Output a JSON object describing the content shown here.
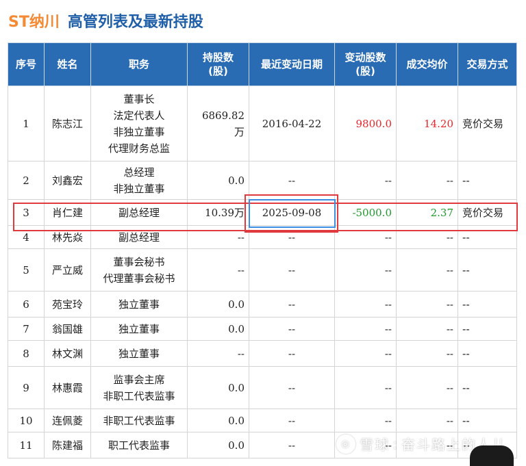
{
  "header": {
    "stock": "ST纳川",
    "title": "高管列表及最新持股"
  },
  "table": {
    "columns": [
      "序号",
      "姓名",
      "职务",
      "持股数\n(股)",
      "最近变动日期",
      "变动股数\n(股)",
      "成交均价",
      "交易方式"
    ],
    "rows": [
      {
        "no": "1",
        "name": "陈志江",
        "position": "董事长\n法定代表人\n非独立董事\n代理财务总监",
        "holding": "6869.82万",
        "date": "2016-04-22",
        "qty": "9800.0",
        "price": "14.20",
        "way": "竞价交易"
      },
      {
        "no": "2",
        "name": "刘鑫宏",
        "position": "总经理\n非独立董事",
        "holding": "0.0",
        "date": "--",
        "qty": "--",
        "price": "--",
        "way": "--"
      },
      {
        "no": "3",
        "name": "肖仁建",
        "position": "副总经理",
        "holding": "10.39万",
        "date": "2025-09-08",
        "qty": "-5000.0",
        "price": "2.37",
        "way": "竞价交易"
      },
      {
        "no": "4",
        "name": "林先焱",
        "position": "副总经理",
        "holding": "--",
        "date": "--",
        "qty": "--",
        "price": "--",
        "way": "--"
      },
      {
        "no": "5",
        "name": "严立威",
        "position": "董事会秘书\n代理董事会秘书",
        "holding": "--",
        "date": "--",
        "qty": "--",
        "price": "--",
        "way": "--"
      },
      {
        "no": "6",
        "name": "苑宝玲",
        "position": "独立董事",
        "holding": "0.0",
        "date": "--",
        "qty": "--",
        "price": "--",
        "way": "--"
      },
      {
        "no": "7",
        "name": "翁国雄",
        "position": "独立董事",
        "holding": "0.0",
        "date": "--",
        "qty": "--",
        "price": "--",
        "way": "--"
      },
      {
        "no": "8",
        "name": "林文渊",
        "position": "独立董事",
        "holding": "--",
        "date": "--",
        "qty": "--",
        "price": "--",
        "way": "--"
      },
      {
        "no": "9",
        "name": "林惠霞",
        "position": "监事会主席\n非职工代表监事",
        "holding": "0.0",
        "date": "--",
        "qty": "--",
        "price": "--",
        "way": "--"
      },
      {
        "no": "10",
        "name": "连佩菱",
        "position": "非职工代表监事",
        "holding": "0.0",
        "date": "--",
        "qty": "--",
        "price": "--",
        "way": "--"
      },
      {
        "no": "11",
        "name": "陈建福",
        "position": "职工代表监事",
        "holding": "0.0",
        "date": "--",
        "qty": "--",
        "price": "--",
        "way": "--"
      }
    ]
  },
  "watermark": {
    "brand": "雪球",
    "author": "奋斗路上的人儿"
  },
  "colors": {
    "header_bg": "#2a6cb4",
    "stock_title": "#f58a34",
    "page_title": "#1f5fa8",
    "positive": "#e8262a",
    "negative": "#1f9a2e",
    "highlight": "#e0393d"
  }
}
